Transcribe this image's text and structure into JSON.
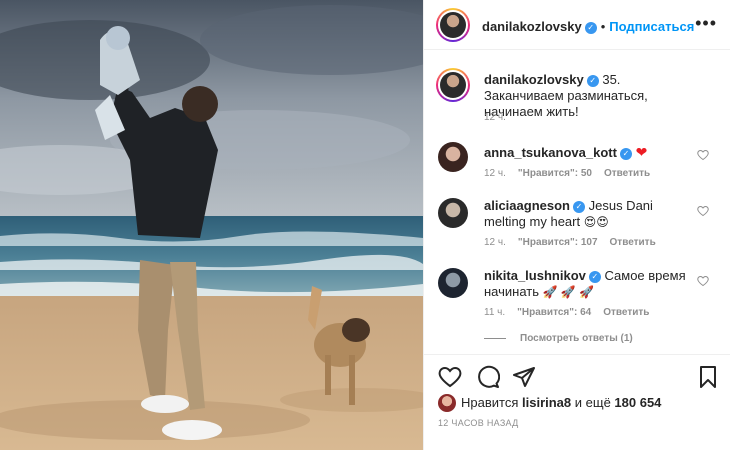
{
  "post": {
    "author": "danilakozlovsky",
    "follow_label": "Подписаться",
    "more_icon": "more-options-icon"
  },
  "caption": {
    "author": "danilakozlovsky",
    "text": "35. Заканчиваем разминаться, начинаем жить!",
    "time": "12 ч."
  },
  "comments": [
    {
      "user": "anna_tsukanova_kott",
      "text": "",
      "emoji": "❤",
      "time": "12 ч.",
      "likes": "\"Нравится\": 50",
      "reply": "Ответить"
    },
    {
      "user": "aliciaagneson",
      "text": "Jesus Dani melting my heart",
      "emoji": "😍😍",
      "time": "12 ч.",
      "likes": "\"Нравится\": 107",
      "reply": "Ответить"
    },
    {
      "user": "nikita_lushnikov",
      "text": "Самое время начинать",
      "emoji": "🚀 🚀 🚀",
      "time": "11 ч.",
      "likes": "\"Нравится\": 64",
      "reply": "Ответить"
    }
  ],
  "view_replies": "Посмотреть ответы (1)",
  "likes_line": {
    "prefix": "Нравится",
    "user": "lisirina8",
    "middle": "и ещё",
    "count": "180 654"
  },
  "posted_ago": "12 ЧАСОВ НАЗАД",
  "colors": {
    "accent": "#0095f6",
    "verified": "#3897f0",
    "muted": "#8e8e8e",
    "heart": "#ed1c24"
  }
}
